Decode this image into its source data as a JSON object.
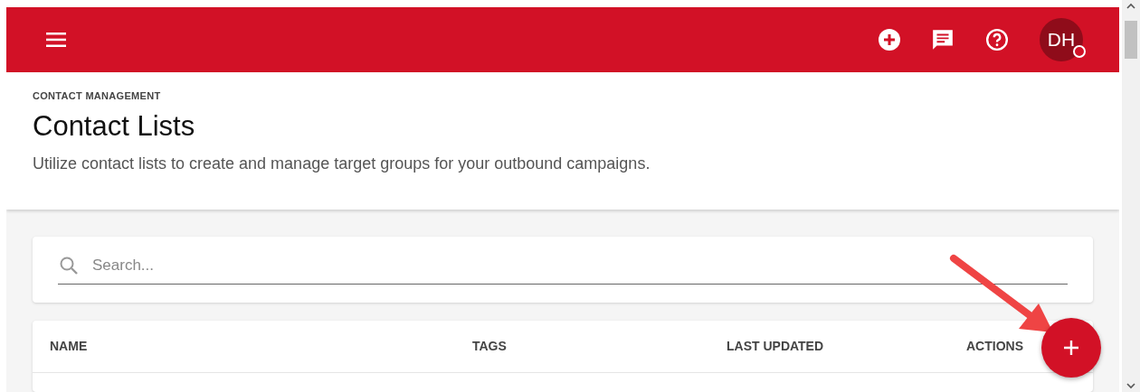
{
  "top_bar": {
    "avatar_initials": "DH"
  },
  "page_header": {
    "breadcrumb": "CONTACT MANAGEMENT",
    "title": "Contact Lists",
    "description": "Utilize contact lists to create and manage target groups for your outbound campaigns."
  },
  "search": {
    "placeholder": "Search..."
  },
  "table": {
    "columns": [
      "NAME",
      "TAGS",
      "LAST UPDATED",
      "ACTIONS"
    ]
  }
}
